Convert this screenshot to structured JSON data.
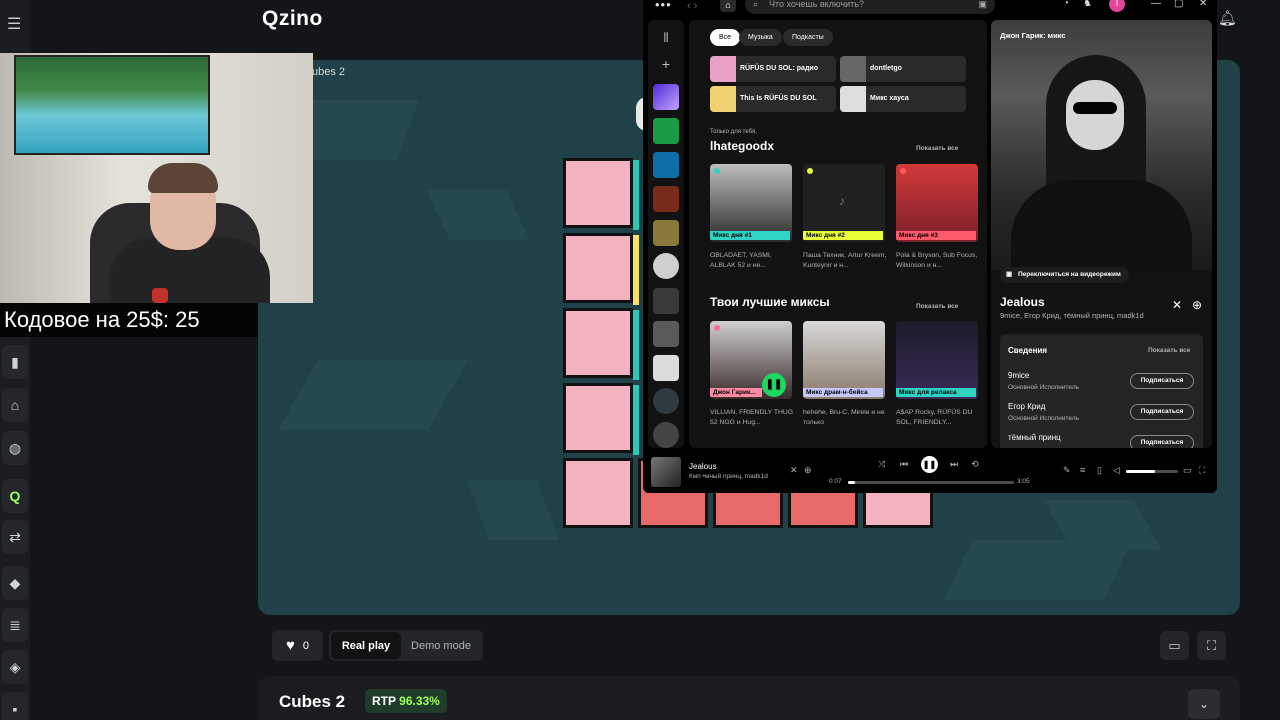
{
  "site": {
    "logo": "Qzino",
    "breadcrumb": "ubes 2"
  },
  "promo_text": "одовое на 25$: 25",
  "promo_prefix": "К",
  "controls": {
    "likes": "0",
    "real_play": "Real play",
    "demo_mode": "Demo mode"
  },
  "game_info": {
    "title": "Cubes 2",
    "rtp_label": "RTP",
    "rtp_value": "96.33%"
  },
  "colors": {
    "accent_green": "#9cff5a",
    "spotify_green": "#1ed760",
    "game_bg": "#1f4147",
    "cube_pink": "#f3b2c0",
    "cube_red": "#e66a6a"
  },
  "spotify": {
    "search_placeholder": "Что хочешь включить?",
    "filters": [
      "Все",
      "Музыка",
      "Подкасты"
    ],
    "quick_picks": [
      "RÜFÜS DU SOL: радио",
      "dontletgo",
      "This Is RÜFÜS DU SOL",
      "Микс хауса"
    ],
    "section1": {
      "small": "Только для тебя,",
      "title": "lhategoodx",
      "show_all": "Показать все",
      "cards": [
        {
          "label": "Микс дня #1",
          "sub": "OBLADAET, YASMI, ALBLAK 52 и не..."
        },
        {
          "label": "Микс дня #2",
          "sub": "Паша Техник, Artur Kreem, Kunteynir и н..."
        },
        {
          "label": "Микс дня #3",
          "sub": "Pola & Bryson, Sub Focus, Wilkinson и н..."
        }
      ]
    },
    "section2": {
      "title": "Твои лучшие миксы",
      "show_all": "Показать все",
      "cards": [
        {
          "label": "Джон Гарик...",
          "sub": "VILLIAN, FRIENDLY THUG 52 NGG и Hug..."
        },
        {
          "label": "Микс драм-н-бейса",
          "sub": "hehehe, Bru-C, Mirèle и не только"
        },
        {
          "label": "Микс для релакса",
          "sub": "A$AP Rocky, RÜFÜS DU SOL, FRIENDLY..."
        }
      ]
    },
    "side": {
      "header": "Джон Гарик: микс",
      "video_button": "Переключиться на видеорежим",
      "track_title": "Jealous",
      "track_artists": "9mice, Егор Крид, тёмный принц, madk1d",
      "credits_title": "Сведения",
      "credits_show_all": "Показать все",
      "credits": [
        {
          "name": "9mice",
          "role": "Основной Исполнитель",
          "button": "Подписаться"
        },
        {
          "name": "Егор Крид",
          "role": "Основной Исполнитель",
          "button": "Подписаться"
        },
        {
          "name": "тёмный принц",
          "role": "",
          "button": "Подписаться"
        }
      ]
    },
    "player": {
      "title": "Jealous",
      "artist": "Кмп •мный принц, madk1d",
      "elapsed": "0:07",
      "duration": "3:05",
      "progress": 0.04,
      "volume": 0.55
    },
    "avatar_letter": "I"
  }
}
